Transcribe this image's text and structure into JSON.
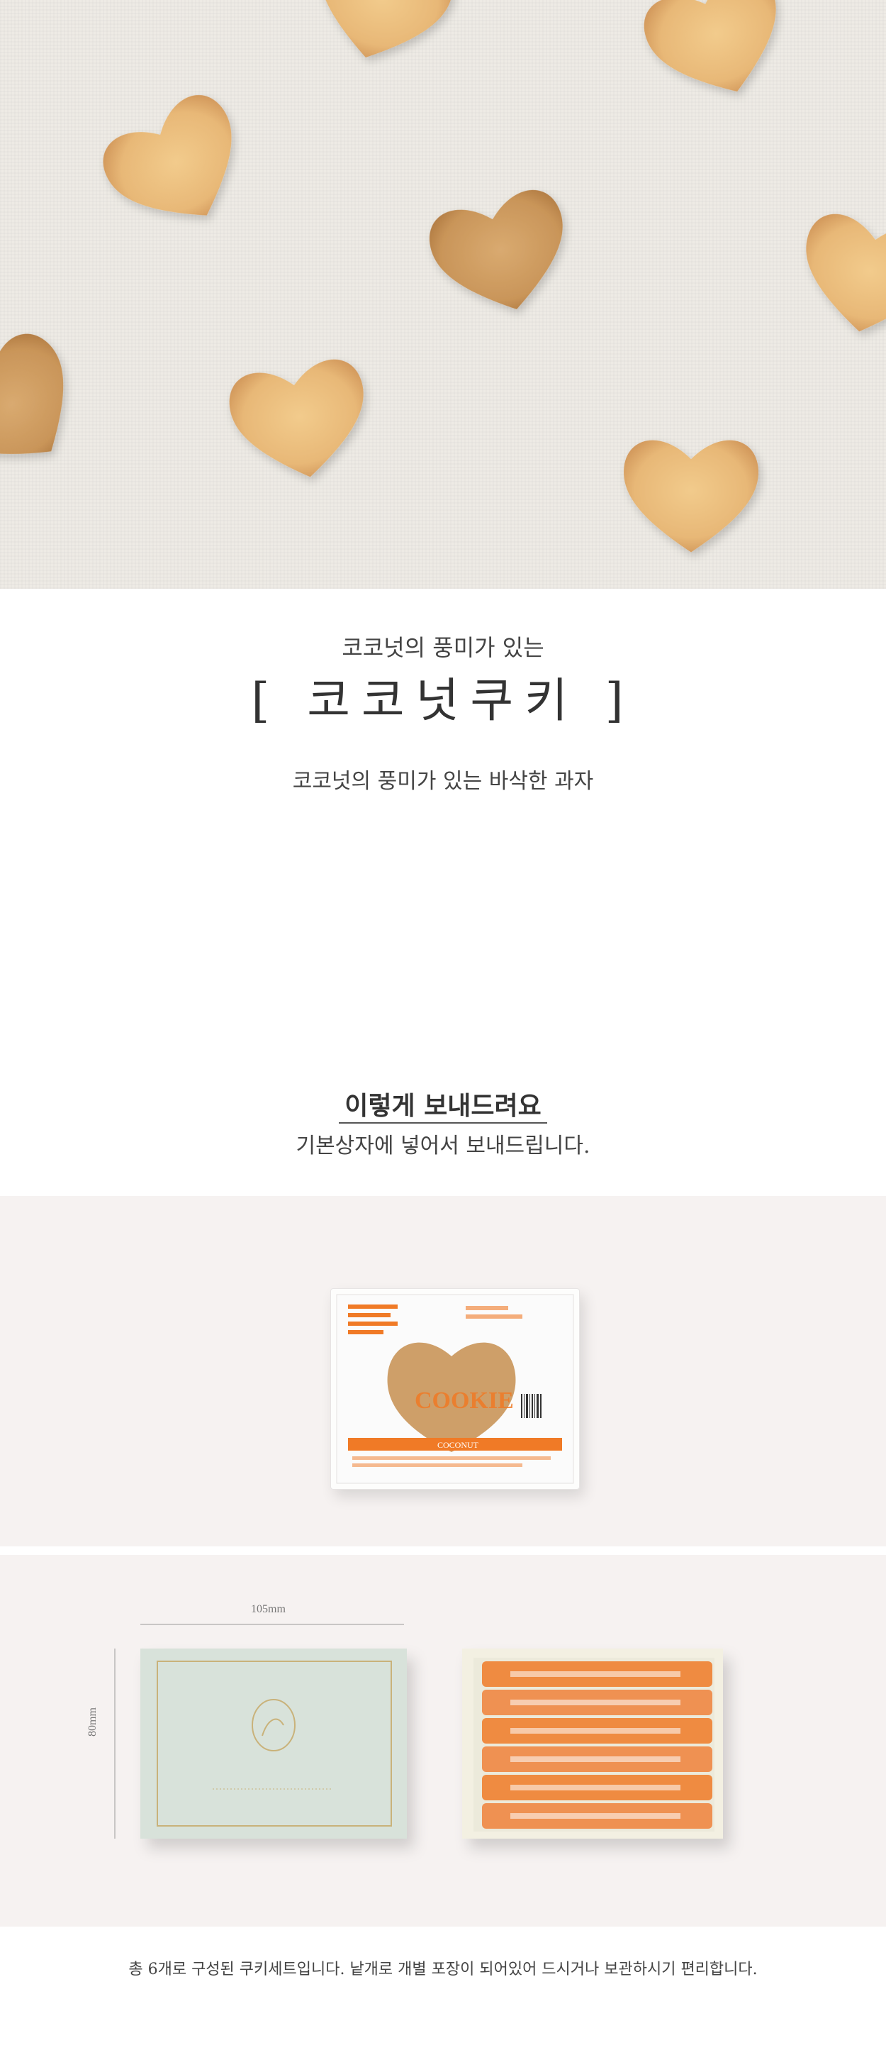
{
  "intro": {
    "subtitle": "코코넛의 풍미가 있는",
    "title": "[ 코코넛쿠키 ]",
    "description": "코코넛의 풍미가 있는 바삭한 과자"
  },
  "shipping": {
    "title": "이렇게 보내드려요",
    "description": "기본상자에 넣어서 보내드립니다."
  },
  "packet": {
    "brand_text": "COOKIE",
    "flavor_text": "COCONUT"
  },
  "box": {
    "width_label": "105mm",
    "height_label": "80mm"
  },
  "footer": {
    "note": "총 6개로 구성된 쿠키세트입니다. 낱개로 개별 포장이 되어있어 드시거나 보관하시기 편리합니다."
  },
  "colors": {
    "cookie": "#e7b97a",
    "cookie_dark": "#cf9a5c",
    "panel_bg": "#f6f2f1",
    "box_green": "#d9e3db",
    "gold": "#c9b27a",
    "orange": "#f07a26"
  }
}
